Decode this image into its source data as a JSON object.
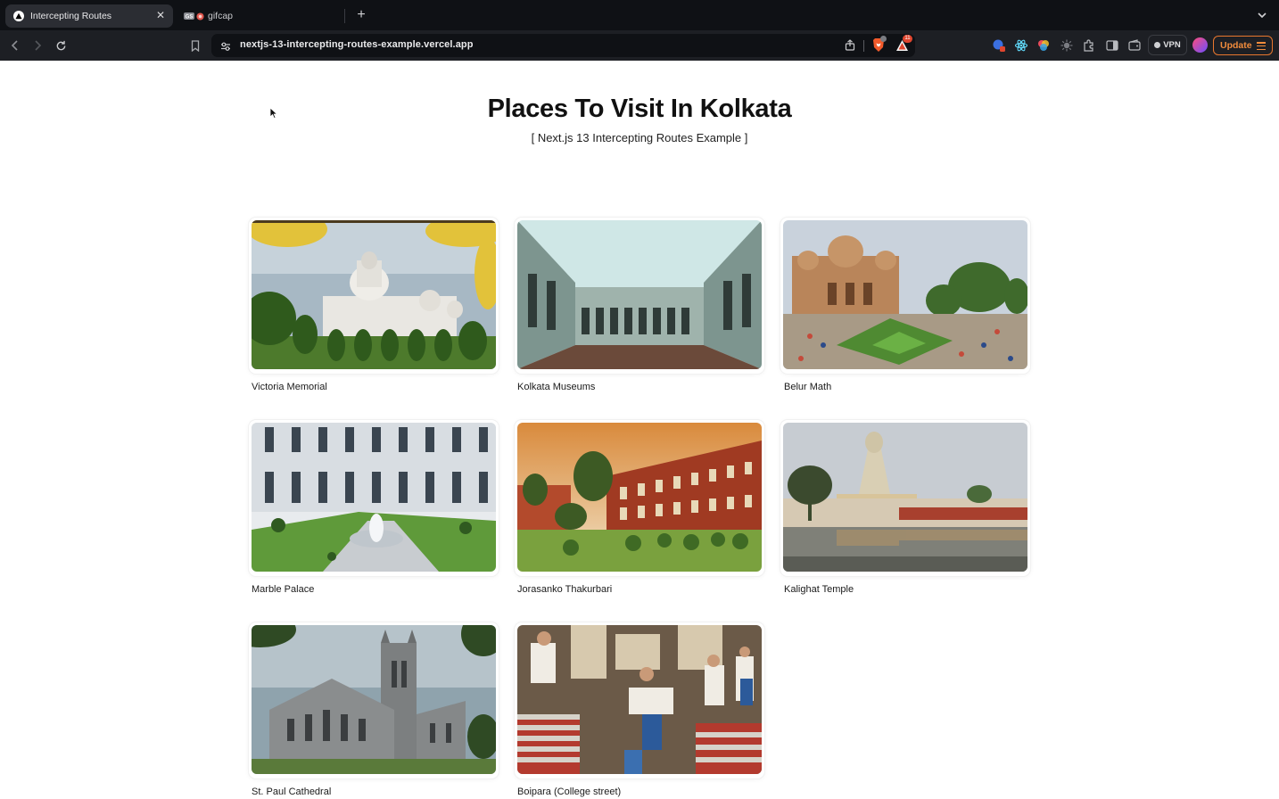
{
  "browser": {
    "tabs": [
      {
        "title": "Intercepting Routes",
        "active": true
      },
      {
        "title": "gifcap",
        "active": false
      }
    ],
    "url": "nextjs-13-intercepting-routes-example.vercel.app",
    "vpn_label": "VPN",
    "update_label": "Update",
    "shields_badge": "",
    "rewards_badge": "11"
  },
  "page": {
    "title": "Places To Visit In Kolkata",
    "subtitle": "[ Next.js 13 Intercepting Routes Example ]",
    "places": [
      {
        "name": "Victoria Memorial",
        "image": "victoria-memorial-photo"
      },
      {
        "name": "Kolkata Museums",
        "image": "kolkata-museum-photo"
      },
      {
        "name": "Belur Math",
        "image": "belur-math-photo"
      },
      {
        "name": "Marble Palace",
        "image": "marble-palace-photo"
      },
      {
        "name": "Jorasanko Thakurbari",
        "image": "jorasanko-thakurbari-photo"
      },
      {
        "name": "Kalighat Temple",
        "image": "kalighat-temple-photo"
      },
      {
        "name": "St. Paul Cathedral",
        "image": "st-paul-cathedral-photo"
      },
      {
        "name": "Boipara (College street)",
        "image": "boipara-photo"
      }
    ]
  },
  "colors": {
    "chrome_bg": "#0f1115",
    "toolbar_bg": "#1d1f24",
    "update_accent": "#f08b3c",
    "page_bg": "#ffffff"
  }
}
